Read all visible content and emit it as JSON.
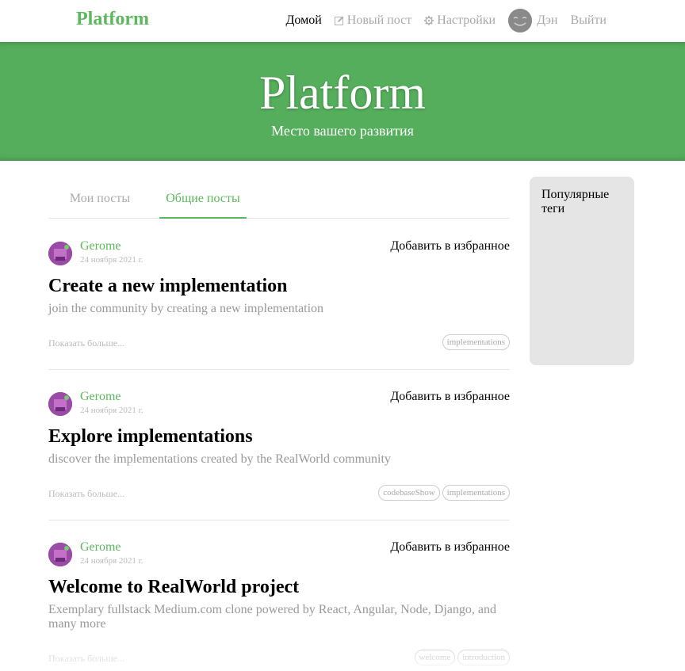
{
  "navbar": {
    "brand": "Platform",
    "items": [
      {
        "label": "Домой",
        "icon": "",
        "active": true
      },
      {
        "label": "Новый пост",
        "icon": "compose-icon",
        "active": false
      },
      {
        "label": "Настройки",
        "icon": "gear-icon",
        "active": false
      },
      {
        "label": "Дэн",
        "icon": "avatar",
        "active": false
      },
      {
        "label": "Выйти",
        "icon": "",
        "active": false
      }
    ]
  },
  "banner": {
    "title": "Platform",
    "subtitle": "Место вашего развития"
  },
  "tabs": [
    {
      "label": "Мои посты",
      "active": false
    },
    {
      "label": "Общие посты",
      "active": true
    }
  ],
  "articles": [
    {
      "author": "Gerome",
      "date": "24 ноября 2021 г.",
      "favorite_label": "Добавить в избранное",
      "title": "Create a new implementation",
      "description": "join the community by creating a new implementation",
      "read_more": "Показать больше...",
      "tags": [
        "implementations"
      ]
    },
    {
      "author": "Gerome",
      "date": "24 ноября 2021 г.",
      "favorite_label": "Добавить в избранное",
      "title": "Explore implementations",
      "description": "discover the implementations created by the RealWorld community",
      "read_more": "Показать больше...",
      "tags": [
        "codebaseShow",
        "implementations"
      ]
    },
    {
      "author": "Gerome",
      "date": "24 ноября 2021 г.",
      "favorite_label": "Добавить в избранное",
      "title": "Welcome to RealWorld project",
      "description": "Exemplary fullstack Medium.com clone powered by React, Angular, Node, Django, and many more",
      "read_more": "Показать больше...",
      "tags": [
        "welcome",
        "introduction"
      ]
    }
  ],
  "sidebar": {
    "title": "Популярные теги"
  },
  "colors": {
    "accent": "#5cb85c",
    "banner": "#55ae5c",
    "sidebar_bg": "#e5e5e5"
  }
}
